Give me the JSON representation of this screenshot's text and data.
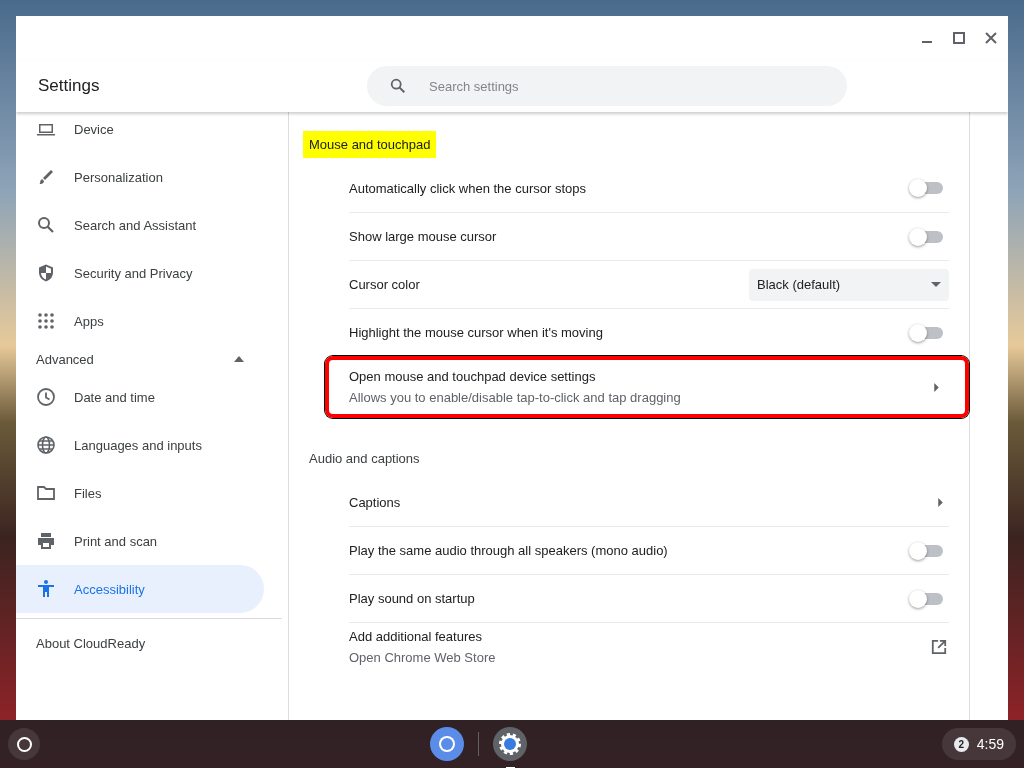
{
  "window": {
    "title": "Settings"
  },
  "search": {
    "placeholder": "Search settings"
  },
  "sidebar": {
    "items": [
      {
        "label": "Device",
        "selected": false
      },
      {
        "label": "Personalization",
        "selected": false
      },
      {
        "label": "Search and Assistant",
        "selected": false
      },
      {
        "label": "Security and Privacy",
        "selected": false
      },
      {
        "label": "Apps",
        "selected": false
      }
    ],
    "advanced": {
      "label": "Advanced",
      "expanded": true,
      "items": [
        {
          "label": "Date and time",
          "selected": false
        },
        {
          "label": "Languages and inputs",
          "selected": false
        },
        {
          "label": "Files",
          "selected": false
        },
        {
          "label": "Print and scan",
          "selected": false
        },
        {
          "label": "Accessibility",
          "selected": true
        }
      ]
    },
    "about": "About CloudReady"
  },
  "sections": [
    {
      "title": "Mouse and touchpad",
      "highlighted": true,
      "rows": [
        {
          "kind": "toggle",
          "label": "Automatically click when the cursor stops",
          "on": false,
          "outlined": false
        },
        {
          "kind": "toggle",
          "label": "Show large mouse cursor",
          "on": false,
          "outlined": false
        },
        {
          "kind": "select",
          "label": "Cursor color",
          "value": "Black (default)",
          "outlined": false
        },
        {
          "kind": "toggle",
          "label": "Highlight the mouse cursor when it's moving",
          "on": false,
          "outlined": false
        },
        {
          "kind": "link",
          "label": "Open mouse and touchpad device settings",
          "sublabel": "Allows you to enable/disable tap-to-click and tap dragging",
          "outlined": true
        }
      ]
    },
    {
      "title": "Audio and captions",
      "highlighted": false,
      "rows": [
        {
          "kind": "link",
          "label": "Captions",
          "outlined": false
        },
        {
          "kind": "toggle",
          "label": "Play the same audio through all speakers (mono audio)",
          "on": false,
          "outlined": false
        },
        {
          "kind": "toggle",
          "label": "Play sound on startup",
          "on": false,
          "outlined": false
        },
        {
          "kind": "external",
          "label": "Add additional features",
          "sublabel": "Open Chrome Web Store",
          "outlined": false
        }
      ]
    }
  ],
  "shelf": {
    "notification_count": "2",
    "time": "4:59"
  }
}
